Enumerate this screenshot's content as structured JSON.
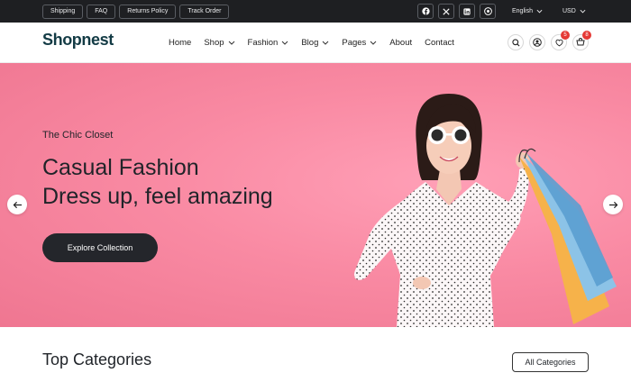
{
  "topbar": {
    "links": [
      "Shipping",
      "FAQ",
      "Returns Policy",
      "Track Order"
    ],
    "social_icons": [
      "facebook-icon",
      "x-icon",
      "linkedin-icon",
      "whatsapp-icon"
    ],
    "language": "English",
    "currency": "USD"
  },
  "header": {
    "logo": "Shopnest",
    "nav": [
      {
        "label": "Home",
        "has_dropdown": false
      },
      {
        "label": "Shop",
        "has_dropdown": true
      },
      {
        "label": "Fashion",
        "has_dropdown": true
      },
      {
        "label": "Blog",
        "has_dropdown": true
      },
      {
        "label": "Pages",
        "has_dropdown": true
      },
      {
        "label": "About",
        "has_dropdown": false
      },
      {
        "label": "Contact",
        "has_dropdown": false
      }
    ],
    "icons": [
      "search-icon",
      "user-icon",
      "heart-icon",
      "cart-icon"
    ],
    "wishlist_count": "5",
    "cart_count": "8",
    "badge_color": "#e53935"
  },
  "hero": {
    "eyebrow": "The Chic Closet",
    "title_line1": "Casual Fashion",
    "title_line2": "Dress up, feel amazing",
    "button": "Explore Collection",
    "background_color": "#f98aa3"
  },
  "categories": {
    "title": "Top Categories",
    "button": "All Categories"
  }
}
